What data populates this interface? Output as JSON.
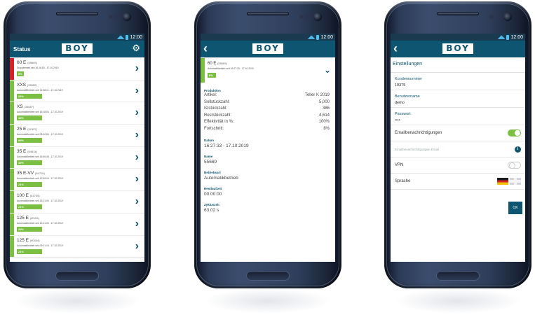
{
  "statusbar": {
    "time": "12:00",
    "signal_icon": "wifi-signal-icon"
  },
  "colors": {
    "appbar": "#0d5571",
    "accent_green": "#7bc043",
    "alert_red": "#d2232a"
  },
  "brand": {
    "logo_text": "BOY"
  },
  "screen1": {
    "title": "Status",
    "rows": [
      {
        "name": "60 E",
        "id": "(55669)",
        "sub": "Stoppbetrieb seit 16:18:53 - 17.10.2019",
        "percent": "8%",
        "progress": 8,
        "state": "red"
      },
      {
        "name": "XXS",
        "id": "(33052)",
        "sub": "Automatikbetrieb seit 14:58:11 - 17.10.2019",
        "percent": "26%",
        "progress": 26,
        "state": "green"
      },
      {
        "name": "XS",
        "id": "(33087)",
        "sub": "Automatikbetrieb seit 14:28:54 - 17.10.2019",
        "percent": "38%",
        "progress": 38,
        "state": "green"
      },
      {
        "name": "25 E",
        "id": "(41307)",
        "sub": "Automatikbetrieb seit 08:32:54 - 17.10.2019",
        "percent": "99%",
        "progress": 99,
        "state": "green"
      },
      {
        "name": "35 E",
        "id": "(64814)",
        "sub": "Automatikbetrieb seit 15:50:45 - 17.10.2019",
        "percent": "33%",
        "progress": 33,
        "state": "green"
      },
      {
        "name": "35 E-VV",
        "id": "(64716)",
        "sub": "Automatikbetrieb seit 12:59:16 - 17.10.2019",
        "percent": "21%",
        "progress": 21,
        "state": "green"
      },
      {
        "name": "100 E",
        "id": "(61705)",
        "sub": "Automatikbetrieb seit 15:21:00 - 17.10.2019",
        "percent": "21%",
        "progress": 21,
        "state": "green"
      },
      {
        "name": "125 E",
        "id": "(60011)",
        "sub": "Automatikbetrieb seit 12:41:00 - 17.10.2019",
        "percent": "39%",
        "progress": 39,
        "state": "green"
      },
      {
        "name": "125 E",
        "id": "(90004)",
        "sub": "Automatikbetrieb seit 09:21:18 - 17.10.2019",
        "percent": "21%",
        "progress": 21,
        "state": "green"
      }
    ]
  },
  "screen2": {
    "head": {
      "name": "60 E",
      "id": "(55669)",
      "sub": "Automatikbetrieb seit 16:27:33 - 17.10.2019",
      "percent": "8%"
    },
    "production_title": "Produktion",
    "production": [
      {
        "k": "Artikel:",
        "v": "Teller K 2019"
      },
      {
        "k": "Sollstückzahl:",
        "v": "5,000"
      },
      {
        "k": "Iststückzahl:",
        "v": "386"
      },
      {
        "k": "Reststückzahl:",
        "v": "4,614"
      },
      {
        "k": "Effektivität in %:",
        "v": "100%"
      },
      {
        "k": "Fortschritt:",
        "v": "8%"
      }
    ],
    "datum_title": "Datum",
    "datum": "16:27:33 - 17.10.2019",
    "name_title": "Name",
    "name": "55669",
    "betriebsart_title": "Betriebsart",
    "betriebsart": "Automatikbetrieb",
    "restlaufzeit_title": "Restlaufzeit",
    "restlaufzeit": "00:00:00",
    "zykluszeit_title": "Zykluszeit",
    "zykluszeit": "63.02 s"
  },
  "screen3": {
    "title": "Einstellungen",
    "kundennummer_label": "Kundennummer",
    "kundennummer": "10375",
    "benutzername_label": "Benutzername",
    "benutzername": "demo",
    "passwort_label": "Passwort",
    "passwort": "••••",
    "email_notif_label": "Emailbenachrichtigungen",
    "email_field_placeholder": "Emailbenachrichtigungen Email",
    "vpn_label": "VPN",
    "sprache_label": "Sprache",
    "ok_label": "OK"
  }
}
